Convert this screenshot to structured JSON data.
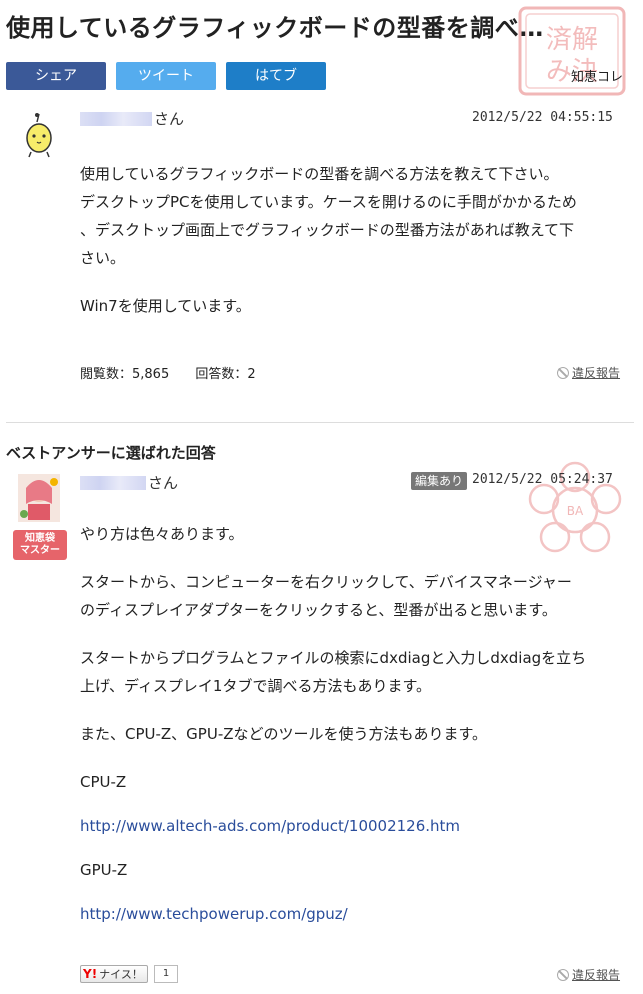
{
  "page": {
    "title": "使用しているグラフィックボードの型番を調べ…"
  },
  "share": {
    "facebook": "シェア",
    "twitter": "ツイート",
    "hatena": "はてブ",
    "note": "知恵コレ"
  },
  "question": {
    "user_suffix": "さん",
    "date": "2012/5/22  04:55:15",
    "paragraphs": [
      "使用しているグラフィックボードの型番を調べる方法を教えて下さい。",
      "デスクトップPCを使用しています。ケースを開けるのに手間がかかるため",
      "、デスクトップ画面上でグラフィックボードの型番方法があれば教えて下",
      "さい。"
    ],
    "paragraph2": "Win7を使用しています。",
    "views_label": "閲覧数：5,865",
    "answers_label": "回答数：2",
    "report": "違反報告"
  },
  "best_answer": {
    "heading": "ベストアンサーに選ばれた回答",
    "user_suffix": "さん",
    "badge_line1": "知恵袋",
    "badge_line2": "マスター",
    "edited": "編集あり",
    "date": "2012/5/22  05:24:37",
    "p1": "やり方は色々あります。",
    "p2a": "スタートから、コンピューターを右クリックして、デバイスマネージャー",
    "p2b": "のディスプレイアダプターをクリックすると、型番が出ると思います。",
    "p3a": "スタートからプログラムとファイルの検索にdxdiagと入力しdxdiagを立ち",
    "p3b": "上げ、ディスプレイ1タブで調べる方法もあります。",
    "p4": "また、CPU-Z、GPU-Zなどのツールを使う方法もあります。",
    "cpuz_label": "CPU-Z",
    "cpuz_link": "http://www.altech-ads.com/product/10002126.htm",
    "gpuz_label": "GPU-Z",
    "gpuz_link": "http://www.techpowerup.com/gpuz/",
    "like_label": "ナイス！",
    "like_count": "1",
    "report": "違反報告"
  },
  "colors": {
    "facebook": "#3b5998",
    "twitter": "#55acee",
    "hatena": "#1e7ec8",
    "link": "#2a4d9b",
    "master_badge": "#e6646a"
  }
}
